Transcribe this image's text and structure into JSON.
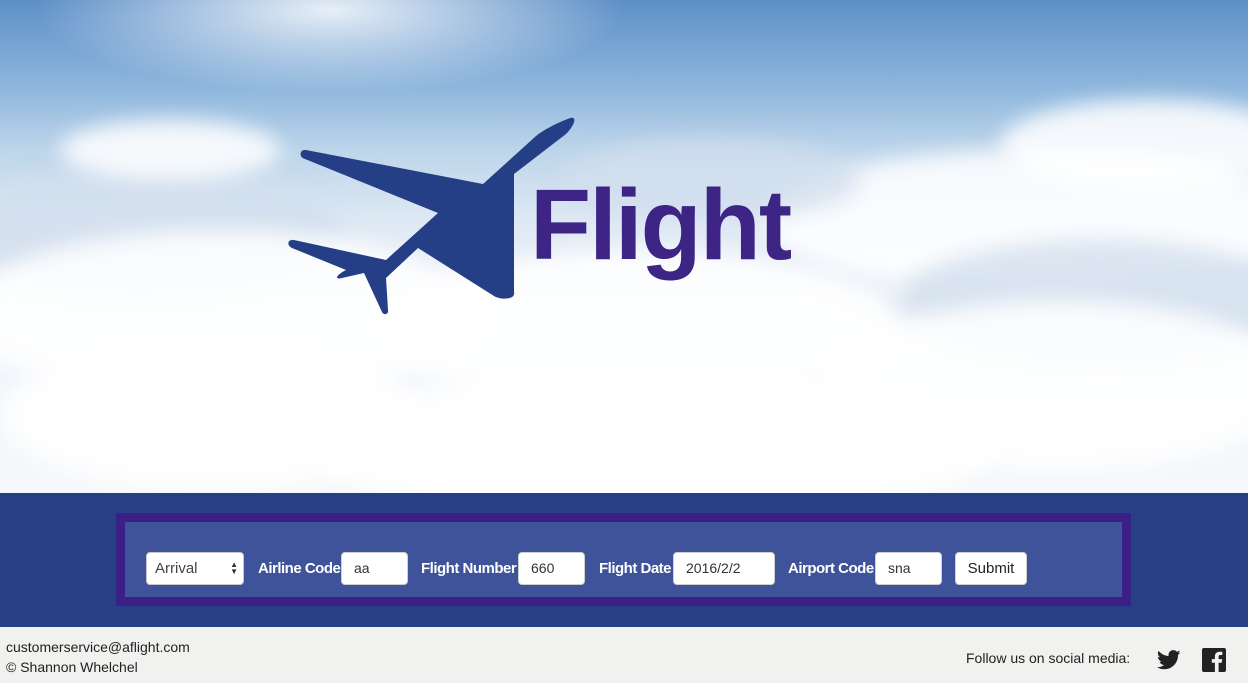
{
  "brand": {
    "name": "Flight"
  },
  "form": {
    "type_select": {
      "value": "Arrival"
    },
    "airline_code": {
      "label": "Airline Code",
      "value": "aa"
    },
    "flight_number": {
      "label": "Flight Number",
      "value": "660"
    },
    "flight_date": {
      "label": "Flight Date",
      "value": "2016/2/2"
    },
    "airport_code": {
      "label": "Airport Code",
      "value": "sna"
    },
    "submit_label": "Submit"
  },
  "footer": {
    "email": "customerservice@aflight.com",
    "copyright": "© Shannon Whelchel",
    "social_label": "Follow us on social media:",
    "icons": [
      "twitter-icon",
      "facebook-icon"
    ]
  },
  "colors": {
    "band": "#273f84",
    "form_border": "#3c1f84",
    "form_bg": "#3e539a",
    "plane": "#253f86",
    "logo_text": "#3d2485"
  }
}
